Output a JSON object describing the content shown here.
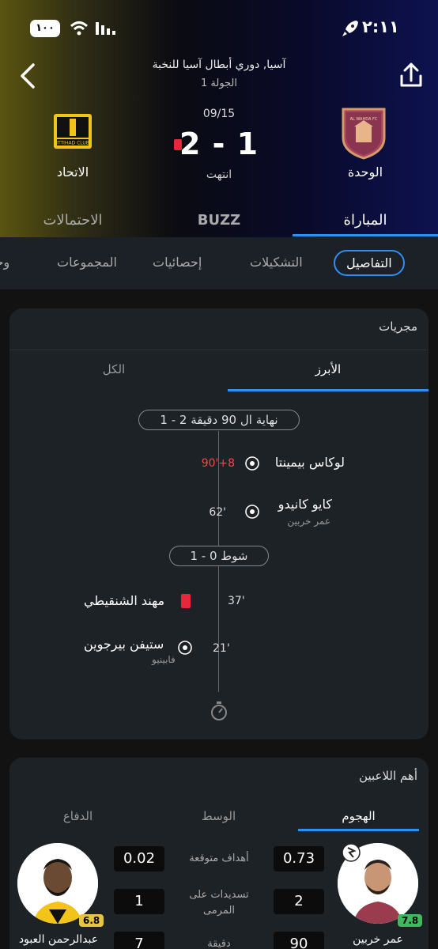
{
  "status_bar": {
    "battery": "١٠٠",
    "time": "٢:١١"
  },
  "header": {
    "league": "آسيا, دوري أبطال آسيا للنخبة",
    "round": "الجولة 1",
    "date": "09/15",
    "score": "2 - 1",
    "match_status": "انتهت",
    "team_home": "الوحدة",
    "team_away": "الاتحاد",
    "away_logo_text": "ITTIHAD CLUB",
    "home_logo_text": "AL WAHDA FC"
  },
  "main_tabs": [
    "المباراة",
    "BUZZ",
    "الاحتمالات"
  ],
  "sub_tabs": [
    "التفاصيل",
    "التشكيلات",
    "إحصائيات",
    "المجموعات",
    "وجه"
  ],
  "events_card": {
    "title": "مجريات",
    "tabs": [
      "الأبرز",
      "الكل"
    ],
    "full_time": "نهاية ال 90 دقيقة 2 - 1",
    "half_time": "شوط 0 - 1",
    "events": [
      {
        "player": "لوكاس بيمينتا",
        "minute": "90'+8",
        "type": "goal"
      },
      {
        "player": "كايو كانيدو",
        "assist": "عمر خربين",
        "minute": "62'",
        "type": "goal"
      },
      {
        "player": "مهند الشنقيطي",
        "minute": "37'",
        "type": "red-card"
      },
      {
        "player": "ستيفن بيرجوين",
        "assist": "فابينيو",
        "minute": "21'",
        "type": "goal"
      }
    ]
  },
  "players_card": {
    "title": "أهم اللاعبين",
    "tabs": [
      "الهجوم",
      "الوسط",
      "الدفاع"
    ],
    "stats": [
      {
        "label": "أهداف متوقعة",
        "home": "0.73",
        "away": "0.02"
      },
      {
        "label": "تسديدات على المرمى",
        "home": "2",
        "away": "1"
      },
      {
        "label": "دقيقة",
        "home": "90",
        "away": "7"
      }
    ],
    "home_player": {
      "name": "عمر خربين",
      "rating": "7.8"
    },
    "away_player": {
      "name": "عبدالرحمن العبود",
      "rating": "6.8"
    }
  },
  "colors": {
    "accent": "#2f8ff2",
    "red_card": "#e8273c",
    "late_minute": "#ef4a4a"
  }
}
